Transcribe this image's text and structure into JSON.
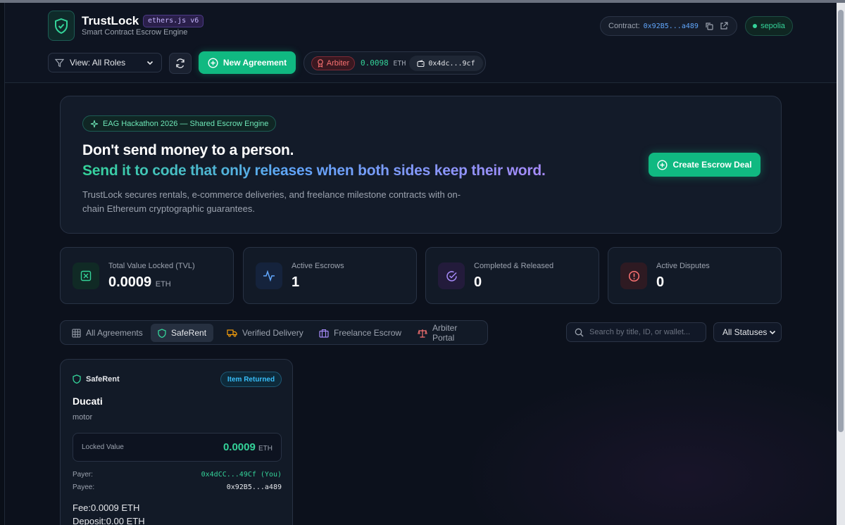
{
  "header": {
    "brand": "TrustLock",
    "lib_badge": "ethers.js v6",
    "subtitle": "Smart Contract Escrow Engine",
    "contract_label": "Contract:",
    "contract_address": "0x92B5...a489",
    "network": "sepolia",
    "view_select": "View: All Roles",
    "new_agreement": "New Agreement",
    "role_badge": "Arbiter",
    "balance": "0.0098",
    "balance_unit": "ETH",
    "wallet_address": "0x4dc...9cf"
  },
  "hero": {
    "badge": "EAG Hackathon 2026 — Shared Escrow Engine",
    "headline": "Don't send money to a person.",
    "subheadline": "Send it to code that only releases when both sides keep their word.",
    "description": "TrustLock secures rentals, e-commerce deliveries, and freelance milestone contracts with on-chain Ethereum cryptographic guarantees.",
    "cta": "Create Escrow Deal"
  },
  "stats": [
    {
      "label": "Total Value Locked (TVL)",
      "value": "0.0009",
      "unit": "ETH"
    },
    {
      "label": "Active Escrows",
      "value": "1"
    },
    {
      "label": "Completed & Released",
      "value": "0"
    },
    {
      "label": "Active Disputes",
      "value": "0"
    }
  ],
  "tabs": [
    "All Agreements",
    "SafeRent",
    "Verified Delivery",
    "Freelance Escrow",
    "Arbiter Portal"
  ],
  "active_tab": "SafeRent",
  "search": {
    "placeholder": "Search by title, ID, or wallet..."
  },
  "status_filter": "All Statuses",
  "card": {
    "type": "SafeRent",
    "status": "Item Returned",
    "title": "Ducati",
    "description": "motor",
    "locked_label": "Locked Value",
    "locked_value": "0.0009",
    "locked_unit": "ETH",
    "payer_label": "Payer:",
    "payer": "0x4dCC...49Cf (You)",
    "payee_label": "Payee:",
    "payee": "0x92B5...a489",
    "fee": "Fee:0.0009 ETH",
    "deposit": "Deposit:0.00 ETH"
  },
  "colors": {
    "accent": "#10b981",
    "background": "#0c111c",
    "info": "#38bdf8",
    "danger": "#f87171"
  }
}
